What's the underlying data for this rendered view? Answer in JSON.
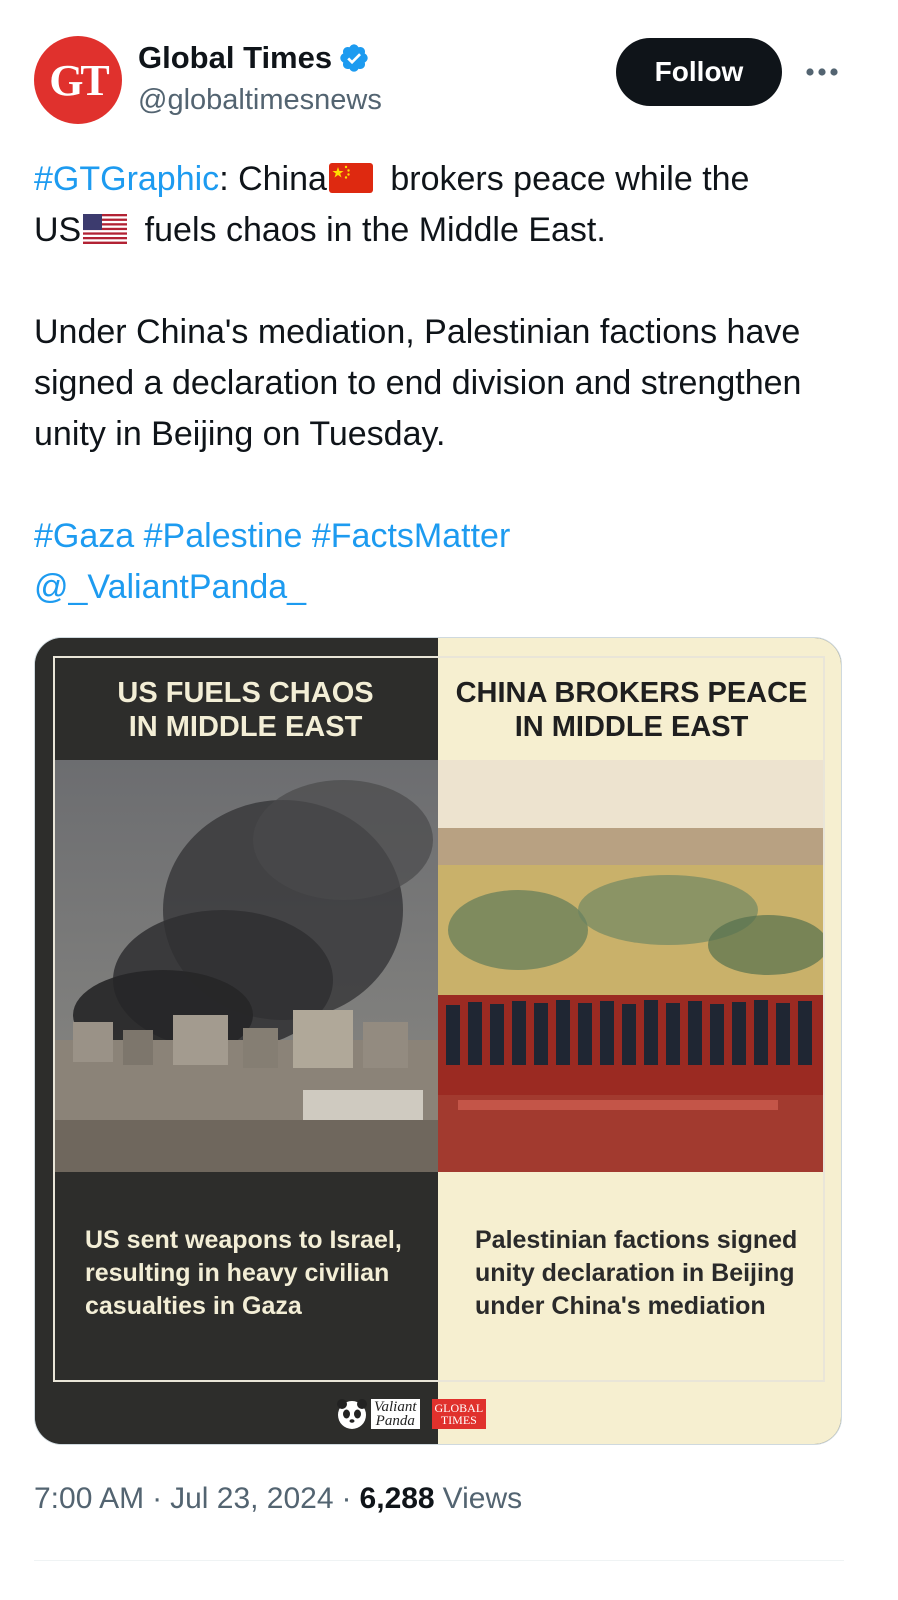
{
  "author": {
    "display_name": "Global Times",
    "handle": "@globaltimesnews",
    "avatar_text": "GT",
    "avatar_color": "#e0312d",
    "verified": true
  },
  "actions": {
    "follow_label": "Follow",
    "more_icon": "more-horizontal-icon"
  },
  "tweet": {
    "line1_hashtag": "#GTGraphic",
    "line1_text_a": ": China",
    "line1_text_b": " brokers peace while the",
    "line2_text_a": "US",
    "line2_text_b": " fuels chaos in the Middle East.",
    "paragraph2": "Under China's mediation, Palestinian factions have signed a declaration to end division and strengthen unity in Beijing on Tuesday.",
    "hashtags": [
      "#Gaza",
      "#Palestine",
      "#FactsMatter"
    ],
    "mention": "@_ValiantPanda_",
    "link_color": "#1d9bf0"
  },
  "media": {
    "left_title": "US FUELS CHAOS\nIN MIDDLE EAST",
    "right_title": "CHINA BROKERS PEACE\nIN MIDDLE EAST",
    "left_caption": "US sent weapons to Israel,\nresulting in heavy civilian\ncasualties in Gaza",
    "right_caption": "Palestinian factions signed\nunity declaration in Beijing\nunder China's mediation",
    "panda_logo_text": "Valiant\nPanda",
    "gt_logo_text": "GLOBAL\nTIMES"
  },
  "meta": {
    "time": "7:00 AM",
    "date": "Jul 23, 2024",
    "views_count": "6,288",
    "views_label": "Views",
    "separator": "·"
  }
}
